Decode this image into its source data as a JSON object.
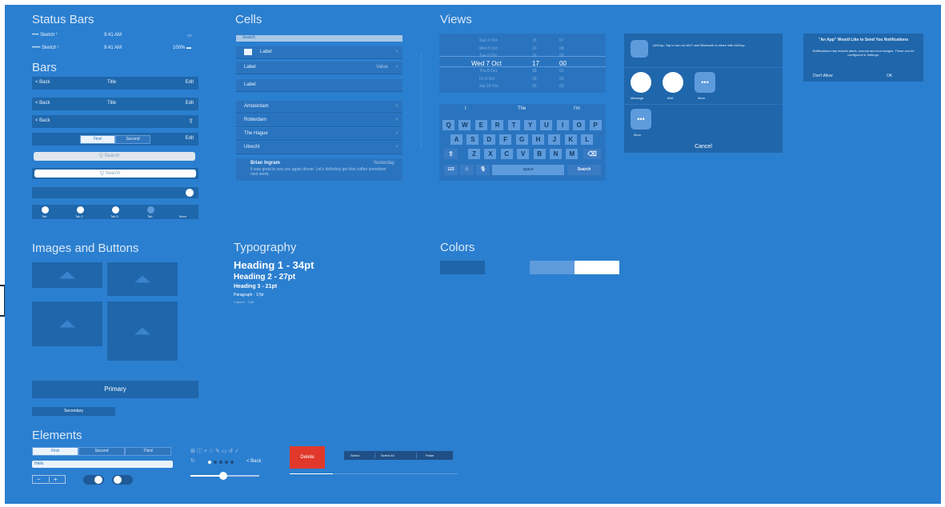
{
  "sections": {
    "status_bars": "Status Bars",
    "bars": "Bars",
    "cells": "Cells",
    "views": "Views",
    "images_buttons": "Images and Buttons",
    "typography": "Typography",
    "colors": "Colors",
    "elements": "Elements"
  },
  "status_bars": [
    {
      "left": "•••• Sketch ᵗ",
      "center": "9:41 AM",
      "right": "▭"
    },
    {
      "left": "••••• Sketch ᵗ",
      "center": "9:41 AM",
      "right": "100% ▬"
    }
  ],
  "bars": {
    "nav1": {
      "back": "< Back",
      "title": "Title",
      "action": "Edit"
    },
    "nav2": {
      "back": "< Back",
      "title": "Title",
      "action": "Edit"
    },
    "nav3": {
      "back": "< Back",
      "action": "⇪"
    },
    "segment": {
      "first": "First",
      "second": "Second",
      "action": "Edit"
    },
    "search1_placeholder": "Q Search",
    "search2_placeholder": "Q Search",
    "tabbar": [
      "Tab",
      "Tab 2",
      "Tab 3",
      "Tab",
      "More"
    ]
  },
  "cells": {
    "search": "Search",
    "label_icon": "Label",
    "label_value": {
      "label": "Label",
      "value": "Value"
    },
    "label_plain": "Label",
    "cities": [
      "Amsterdam",
      "Rotterdam",
      "The Hague",
      "Utrecht"
    ],
    "notification": {
      "title": "Brian Ingram",
      "time": "Yesterday",
      "body": "It was great to see you again dinner. Let's definitely get that coffee sometime next week."
    }
  },
  "picker": {
    "rows": [
      {
        "date": "Sun 4 Oct",
        "hour": "15",
        "min": "57"
      },
      {
        "date": "Mon 5 Oct",
        "hour": "15",
        "min": "58"
      },
      {
        "date": "Tue 6 Oct",
        "hour": "16",
        "min": "59"
      },
      {
        "date": "Wed 7 Oct",
        "hour": "17",
        "min": "00"
      },
      {
        "date": "Thu 8 Oct",
        "hour": "18",
        "min": "01"
      },
      {
        "date": "Fri 9 Oct",
        "hour": "19",
        "min": "02"
      },
      {
        "date": "Sat 10 Oct",
        "hour": "20",
        "min": "03"
      }
    ]
  },
  "keyboard": {
    "suggestions": [
      "I",
      "The",
      "I'm"
    ],
    "row1": [
      "Q",
      "W",
      "E",
      "R",
      "T",
      "Y",
      "U",
      "I",
      "O",
      "P"
    ],
    "row2": [
      "A",
      "S",
      "D",
      "F",
      "G",
      "H",
      "J",
      "K",
      "L"
    ],
    "row3": [
      "Z",
      "X",
      "C",
      "V",
      "B",
      "N",
      "M"
    ],
    "shift": "⇧",
    "backspace": "⌫",
    "numbers": "123",
    "emoji": "☺",
    "mic": "🎙",
    "space": "space",
    "search": "Search"
  },
  "share_sheet": {
    "airdrop_text": "AirDrop. Tap to turn on Wi-Fi and Bluetooth to share with AirDrop.",
    "share_items": [
      "Message",
      "Mail",
      "More"
    ],
    "action_items": [
      "More"
    ],
    "more_glyph": "•••",
    "cancel": "Cancel"
  },
  "alert": {
    "title": "\"An App\" Would Like to Send You Notifications",
    "message": "Notifications may include alerts, sounds and icon badges. These can be configured in Settings.",
    "deny": "Don't Allow",
    "ok": "OK"
  },
  "typography": {
    "h1": "Heading 1 - 34pt",
    "h2": "Heading 2 - 27pt",
    "h3": "Heading 3 - 21pt",
    "paragraph": "Paragraph - 17pt",
    "caption": "Caption - 12pt"
  },
  "colors": [
    "#1e64a8",
    "#2b7fd0",
    "#5e9bdc",
    "#ffffff"
  ],
  "buttons": {
    "primary": "Primary",
    "secondary": "Secondary"
  },
  "elements": {
    "segment": [
      "First",
      "Second",
      "Third"
    ],
    "text_field": "Hello",
    "stepper": [
      "−",
      "+"
    ],
    "back": "< Back",
    "delete": "Delete",
    "toolbar_actions": [
      "Select",
      "Select All",
      "Paste"
    ],
    "icon_row": "⊞ ⓘ + ☆ ✎ ▭ ↺ ✓",
    "icon_row2": "↻"
  }
}
